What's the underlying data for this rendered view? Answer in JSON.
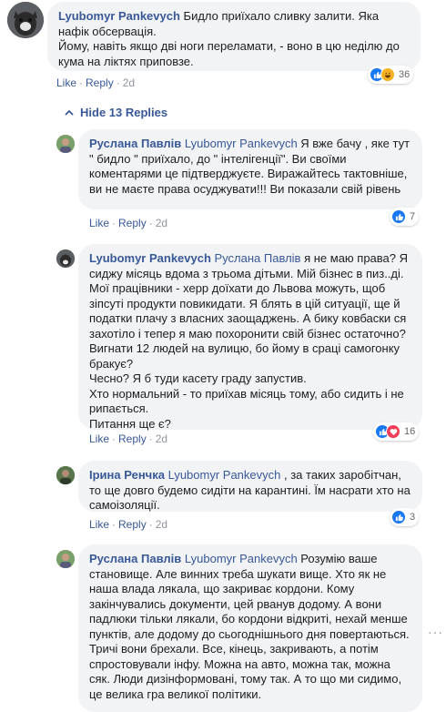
{
  "actions": {
    "like": "Like",
    "reply": "Reply"
  },
  "main_comment": {
    "author": "Lyubomyr Pankevych",
    "text": "Бидло приїхало сливку залити. Яка нафік обсервація.\nЙому, навіть якщо дві ноги переламати, - воно в цю неділю до кума на ліктях приповзе.",
    "time": "2d",
    "reaction_count": "36",
    "reaction_icons": [
      "like-icon",
      "haha-icon"
    ]
  },
  "hide_replies": {
    "label": "Hide 13 Replies"
  },
  "replies": [
    {
      "author": "Руслана Павлів",
      "mention": "Lyubomyr Pankevych",
      "text": " Я вже бачу , яке тут \" бидло \" приїхало, до \" інтелігенції\". Ви своїми коментарями це підтверджуєте. Виражайтесь тактовніше, ви не маєте права осуджувати!!! Ви показали свій рівень",
      "time": "2d",
      "reaction_count": "7",
      "reaction_icons": [
        "like-icon"
      ]
    },
    {
      "author": "Lyubomyr Pankevych",
      "mention": "Руслана Павлів",
      "text": " я не маю права? Я сиджу місяць вдома з трьома дітьми. Мій бізнес в пиз..ді. Мої працівники - херр доїхати до Львова можуть, щоб зіпсуті продукти повикидати. Я блять в цій ситуації, ще й податки плачу з власних заощаджень. А бику ковбаски ся захотіло і тепер я маю похоронити свій бізнес остаточно? Вигнати 12 людей на вулицю, бо йому в сраці самогонку бракує?\nЧесно? Я б туди касету граду запустив.\nХто нормальний - то приїхав місяць тому, або сидить і не рипається.\nПитання ще є?",
      "time": "2d",
      "reaction_count": "16",
      "reaction_icons": [
        "like-icon",
        "love-icon"
      ]
    },
    {
      "author": "Ірина Ренчка",
      "mention": "Lyubomyr Pankevych",
      "text": " , за таких заробітчан, то ще довго будемо сидіти на карантині. Їм насрати хто на самоізоляції.",
      "time": "2d",
      "reaction_count": "3",
      "reaction_icons": [
        "like-icon"
      ]
    },
    {
      "author": "Руслана Павлів",
      "mention": "Lyubomyr Pankevych",
      "text": " Розумію ваше становище. Але винних треба шукати вище. Хто як не наша влада лякала, що закриває кордони. Кому закінчувались документи, цей рванув додому. А вони падлюки тільки лякали, бо кордони відкриті, нехай менше пунктів, але додому до сьогоднішнього дня повертаються. Тричі вони брехали. Все, кінець, закривають, а потім спростовували інфу. Можна на авто, можна так, можна сяк. Люди дизінформовані, тому так. А то що ми сидимо, це велика гра великої політики."
    }
  ]
}
